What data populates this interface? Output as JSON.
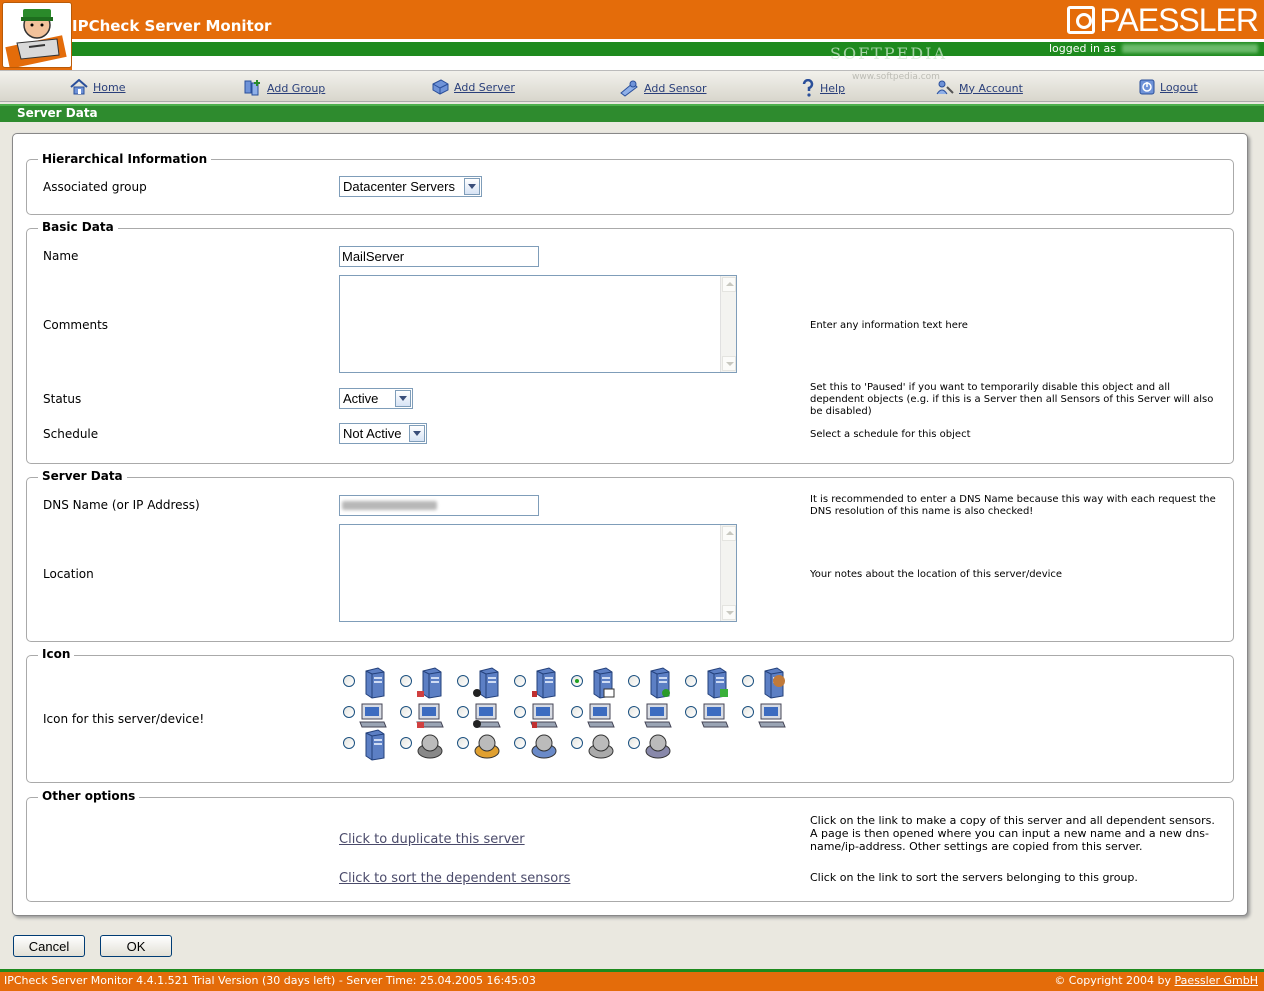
{
  "app": {
    "title": "IPCheck Server Monitor",
    "brand": "PAESSLER",
    "logged_in_label": "logged in as",
    "watermark": "SOFTPEDIA",
    "watermark_url": "www.softpedia.com"
  },
  "nav": [
    {
      "label": "Home",
      "icon": "house-icon"
    },
    {
      "label": "Add Group",
      "icon": "group-icon"
    },
    {
      "label": "Add Server",
      "icon": "server-icon"
    },
    {
      "label": "Add Sensor",
      "icon": "sensor-icon"
    },
    {
      "label": "Help",
      "icon": "help-icon"
    },
    {
      "label": "My Account",
      "icon": "account-icon"
    },
    {
      "label": "Logout",
      "icon": "logout-icon"
    }
  ],
  "section_title": "Server Data",
  "hier": {
    "legend": "Hierarchical Information",
    "group_label": "Associated group",
    "group_value": "Datacenter Servers"
  },
  "basic": {
    "legend": "Basic Data",
    "name_label": "Name",
    "name_value": "MailServer",
    "comments_label": "Comments",
    "comments_hint": "Enter any information text here",
    "status_label": "Status",
    "status_value": "Active",
    "status_hint": "Set this to 'Paused' if you want to temporarily disable this object and all dependent objects (e.g. if this is a Server then all Sensors of this Server will also be disabled)",
    "schedule_label": "Schedule",
    "schedule_value": "Not Active",
    "schedule_hint": "Select a schedule for this object"
  },
  "server": {
    "legend": "Server Data",
    "dns_label": "DNS Name (or IP Address)",
    "dns_hint": "It is recommended to enter a DNS Name because this way with each request the DNS resolution of this name is also checked!",
    "location_label": "Location",
    "location_hint": "Your notes about the location of this server/device"
  },
  "icon_sec": {
    "legend": "Icon",
    "label": "Icon for this server/device!",
    "selected_index": 4
  },
  "other": {
    "legend": "Other options",
    "dup_link": "Click to duplicate this server",
    "sort_link": "Click to sort the dependent sensors",
    "dup_hint": "Click on the link to make a copy of this server and all dependent sensors. A page is then opened where you can input a new name and a new dns-name/ip-address. Other settings are copied from this server.",
    "sort_hint": "Click on the link to sort the servers belonging to this group."
  },
  "buttons": {
    "cancel": "Cancel",
    "ok": "OK"
  },
  "footer": {
    "left": "IPCheck Server Monitor 4.4.1.521 Trial Version (30 days left) - Server Time: 25.04.2005 16:45:03",
    "copyright": "© Copyright 2004 by",
    "company": "Paessler GmbH"
  },
  "colors": {
    "orange": "#e46c0a",
    "green": "#2e8b2e"
  }
}
